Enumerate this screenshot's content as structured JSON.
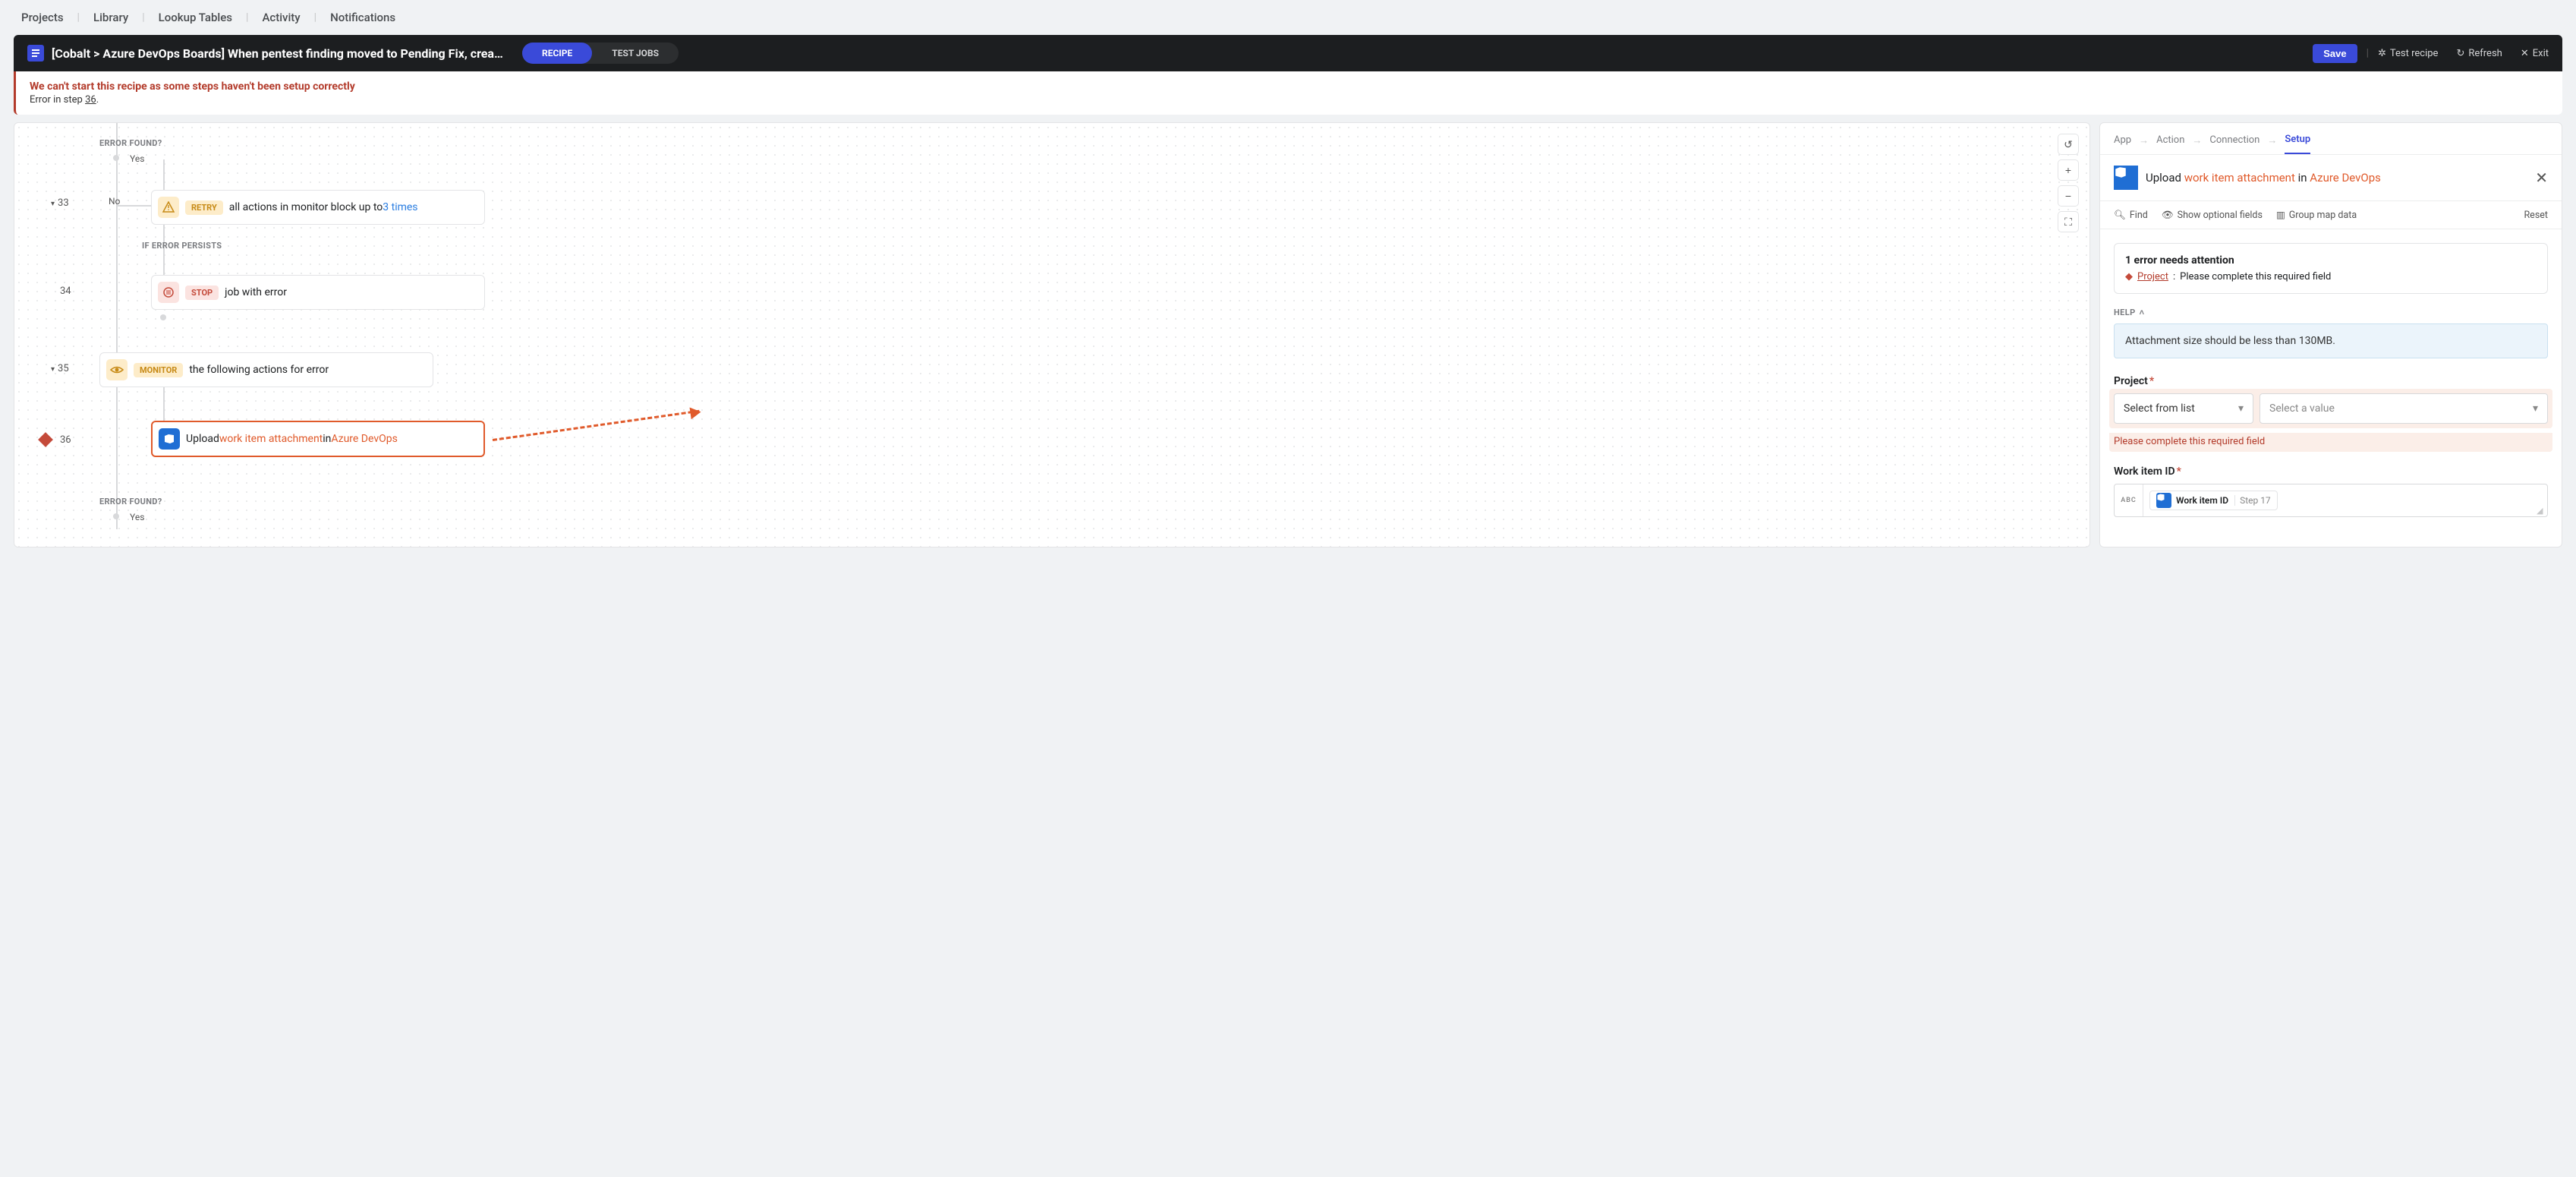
{
  "topnav": {
    "items": [
      "Projects",
      "Library",
      "Lookup Tables",
      "Activity",
      "Notifications"
    ]
  },
  "header": {
    "title": "[Cobalt > Azure DevOps Boards] When pentest finding moved to Pending Fix, create wor…",
    "toggle": {
      "recipe": "RECIPE",
      "jobs": "TEST JOBS"
    },
    "save": "Save",
    "test": "Test recipe",
    "refresh": "Refresh",
    "exit": "Exit"
  },
  "error_banner": {
    "line1": "We can't start this recipe as some steps haven't been setup correctly",
    "line2_prefix": "Error in step ",
    "step": "36",
    "line2_suffix": "."
  },
  "canvas": {
    "labels": {
      "error_found": "ERROR FOUND?",
      "if_error_persists": "IF ERROR PERSISTS",
      "yes": "Yes",
      "no": "No"
    },
    "steps": {
      "s33": {
        "num": "33",
        "chip": "RETRY",
        "text_prefix": "all actions in monitor block up to ",
        "link": "3 times"
      },
      "s34": {
        "num": "34",
        "chip": "STOP",
        "text": "job with error"
      },
      "s35": {
        "num": "35",
        "chip": "MONITOR",
        "text": "the following actions for error"
      },
      "s36": {
        "num": "36",
        "prefix": "Upload ",
        "orange": "work item attachment",
        "mid": " in ",
        "link": "Azure DevOps"
      }
    }
  },
  "right": {
    "crumbs": {
      "app": "App",
      "action": "Action",
      "connection": "Connection",
      "setup": "Setup"
    },
    "title": {
      "prefix": "Upload ",
      "orange": "work item attachment",
      "mid": " in ",
      "link": "Azure DevOps"
    },
    "toolbar": {
      "find": "Find",
      "optional": "Show optional fields",
      "groupmap": "Group map data",
      "reset": "Reset"
    },
    "errbox": {
      "heading": "1 error needs attention",
      "project": "Project",
      "msg": "Please complete this required field"
    },
    "help": {
      "label": "HELP",
      "text": "Attachment size should be less than 130MB."
    },
    "project": {
      "label": "Project",
      "select_from_list": "Select from list",
      "select_value": "Select a value",
      "err": "Please complete this required field"
    },
    "workitem": {
      "label": "Work item ID",
      "abc": "ABC",
      "pill_label": "Work item ID",
      "pill_step": "Step 17"
    }
  }
}
